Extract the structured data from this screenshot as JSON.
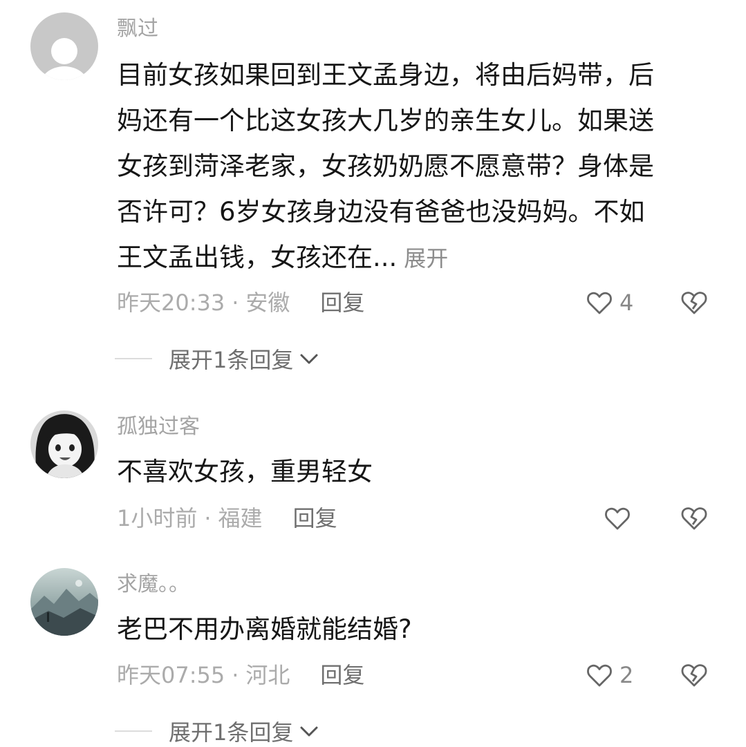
{
  "comments": [
    {
      "user": "飘过",
      "avatar_icon": "default-user-icon",
      "lines": [
        "目前女孩如果回到王文孟身边，将由后妈带，后",
        "妈还有一个比这女孩大几岁的亲生女儿。如果送",
        "女孩到菏泽老家，女孩奶奶愿不愿意带？身体是",
        "否许可？6岁女孩身边没有爸爸也没妈妈。不如",
        "王文孟出钱，女孩还在..."
      ],
      "expand_label": "展开",
      "time": "昨天20:33",
      "location": "安徽",
      "reply_label": "回复",
      "likes": "4",
      "more_replies": "展开1条回复"
    },
    {
      "user": "孤独过客",
      "avatar_icon": "anime-girl-avatar",
      "text": "不喜欢女孩，重男轻女",
      "time": "1小时前",
      "location": "福建",
      "reply_label": "回复",
      "likes": ""
    },
    {
      "user": "求魔。。",
      "avatar_icon": "landscape-avatar",
      "text": "老巴不用办离婚就能结婚?",
      "time": "昨天07:55",
      "location": "河北",
      "reply_label": "回复",
      "likes": "2",
      "more_replies": "展开1条回复"
    }
  ],
  "separator": "·"
}
